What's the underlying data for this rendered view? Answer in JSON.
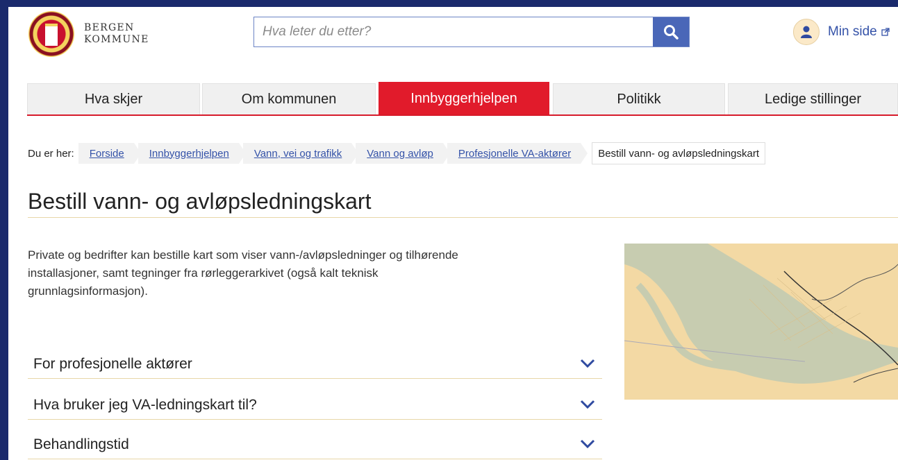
{
  "header": {
    "logo_line1": "BERGEN",
    "logo_line2": "KOMMUNE",
    "search_placeholder": "Hva leter du etter?",
    "search_icon": "search-icon",
    "minside_label": "Min side",
    "minside_icon": "user-icon",
    "external_icon": "external-link-icon"
  },
  "nav": {
    "tabs": [
      {
        "label": "Hva skjer",
        "active": false
      },
      {
        "label": "Om kommunen",
        "active": false
      },
      {
        "label": "Innbyggerhjelpen",
        "active": true
      },
      {
        "label": "Politikk",
        "active": false
      },
      {
        "label": "Ledige stillinger",
        "active": false
      }
    ]
  },
  "breadcrumb": {
    "label": "Du er her:",
    "items": [
      "Forside",
      "Innbyggerhjelpen",
      "Vann, vei og trafikk",
      "Vann og avløp",
      "Profesjonelle VA-aktører"
    ],
    "current": "Bestill vann- og avløpsledningskart"
  },
  "main": {
    "title": "Bestill vann- og avløpsledningskart",
    "intro": "Private og bedrifter kan bestille kart som viser vann-/avløpsledninger og tilhørende installasjoner, samt tegninger fra rørleggerarkivet (også kalt teknisk grunnlagsinformasjon).",
    "accordion": [
      {
        "title": "For profesjonelle aktører"
      },
      {
        "title": "Hva bruker jeg VA-ledningskart til?"
      },
      {
        "title": "Behandlingstid"
      }
    ]
  },
  "colors": {
    "accent": "#e11b2b",
    "link": "#3452a8",
    "frame": "#1a2a6c",
    "divider": "#e8d7a8"
  }
}
